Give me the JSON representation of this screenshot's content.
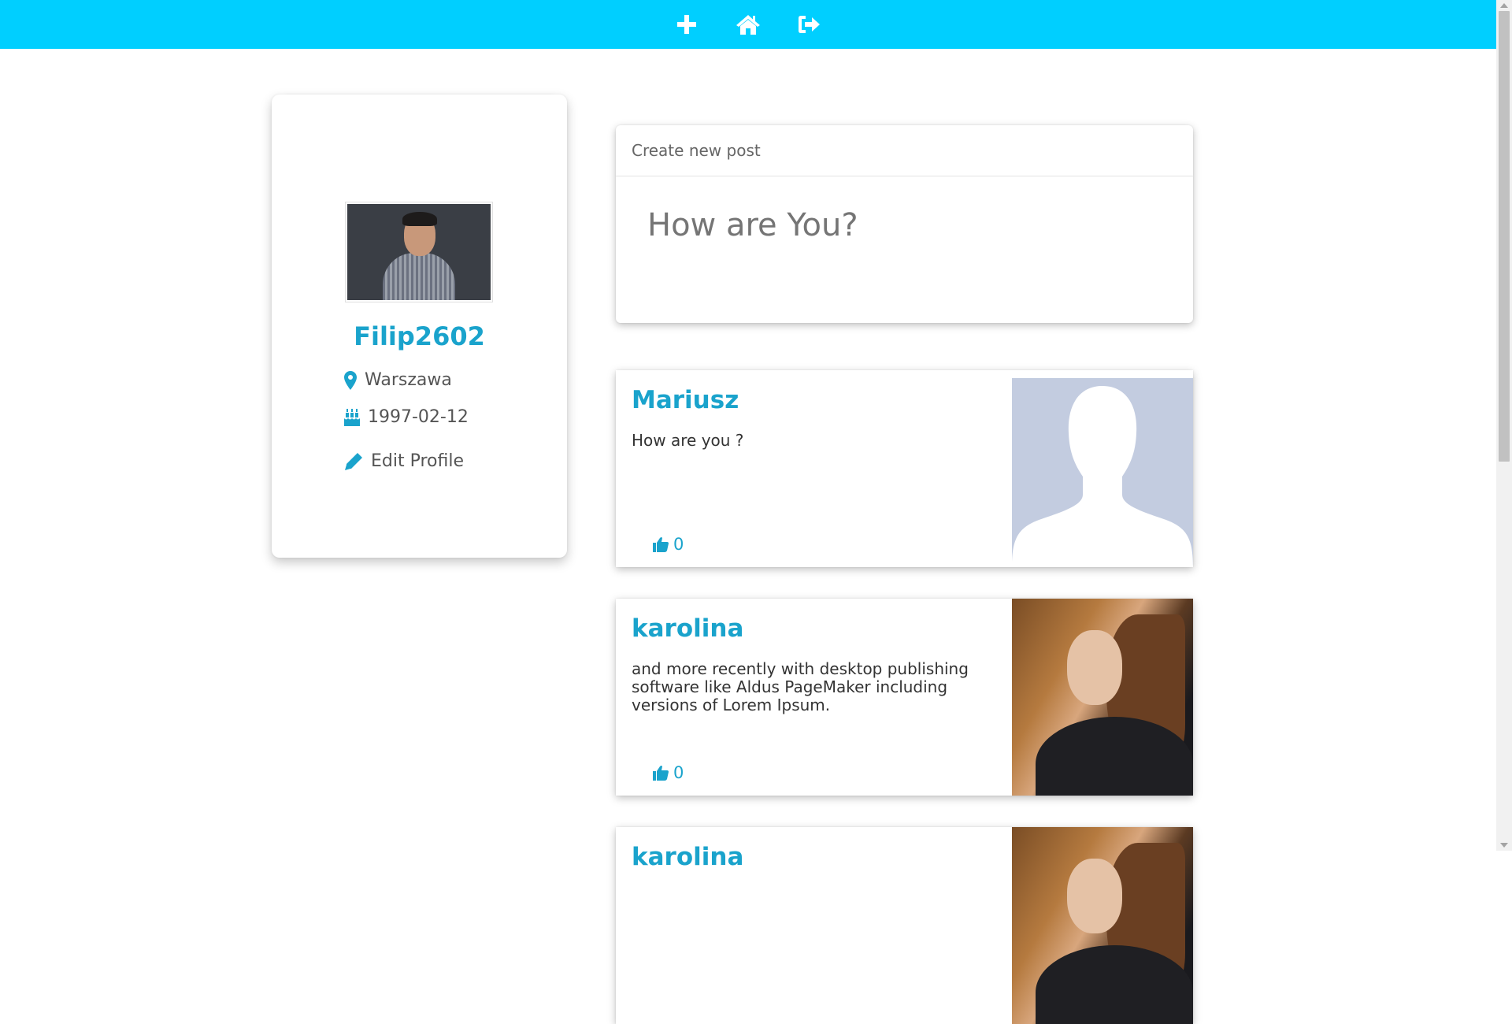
{
  "colors": {
    "accent": "#00cfff",
    "brand_text": "#1aa3cc"
  },
  "nav": {
    "icons": [
      "plus-icon",
      "home-icon",
      "sign-out-icon"
    ]
  },
  "profile": {
    "username": "Filip2602",
    "location": "Warszawa",
    "birthday": "1997-02-12",
    "edit_label": "Edit Profile"
  },
  "create_post": {
    "header": "Create new post",
    "placeholder": "How are You?"
  },
  "posts": [
    {
      "author": "Mariusz",
      "text": "How are you ?",
      "likes": "0",
      "image": "default-avatar-silhouette"
    },
    {
      "author": "karolina",
      "text": "and more recently with desktop publishing software like Aldus PageMaker including versions of Lorem Ipsum.",
      "likes": "0",
      "image": "woman-portrait-photo"
    },
    {
      "author": "karolina",
      "image": "woman-portrait-photo"
    }
  ]
}
